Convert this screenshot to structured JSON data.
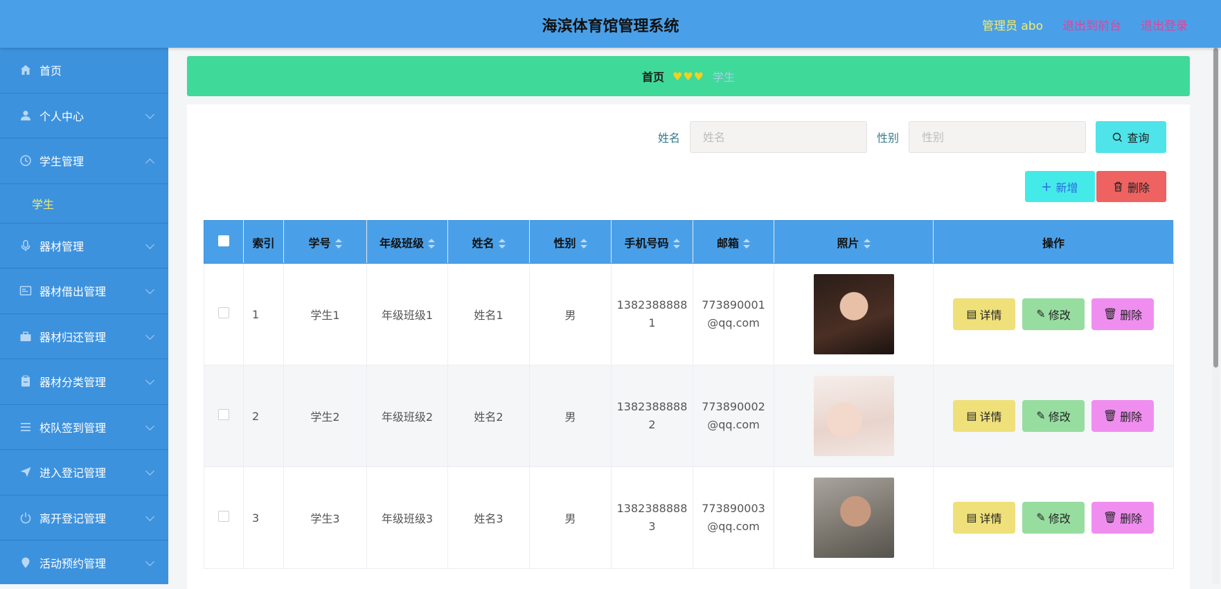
{
  "header": {
    "title": "海滨体育馆管理系统",
    "user": "管理员 abo",
    "to_front": "退出到前台",
    "logout": "退出登录"
  },
  "sidebar": {
    "items": [
      {
        "label": "首页",
        "icon": "home-icon"
      },
      {
        "label": "个人中心",
        "icon": "user-icon"
      },
      {
        "label": "学生管理",
        "icon": "clock-icon",
        "expanded": true
      },
      {
        "label": "器材管理",
        "icon": "microphone-icon"
      },
      {
        "label": "器材借出管理",
        "icon": "card-icon"
      },
      {
        "label": "器材归还管理",
        "icon": "briefcase-icon"
      },
      {
        "label": "器材分类管理",
        "icon": "clipboard-icon"
      },
      {
        "label": "校队签到管理",
        "icon": "list-icon"
      },
      {
        "label": "进入登记管理",
        "icon": "send-icon"
      },
      {
        "label": "离开登记管理",
        "icon": "power-icon"
      },
      {
        "label": "活动预约管理",
        "icon": "pin-icon"
      }
    ],
    "submenu_label": "学生"
  },
  "breadcrumb": {
    "home": "首页",
    "separator": "♥♥♥",
    "current": "学生"
  },
  "search": {
    "name_label": "姓名",
    "name_placeholder": "姓名",
    "gender_label": "性别",
    "gender_placeholder": "性别",
    "query_label": "查询"
  },
  "actions": {
    "add_label": "新增",
    "delete_label": "删除"
  },
  "table": {
    "headers": {
      "index": "索引",
      "student_no": "学号",
      "grade_class": "年级班级",
      "name": "姓名",
      "gender": "性别",
      "phone": "手机号码",
      "email": "邮箱",
      "photo": "照片",
      "ops": "操作"
    },
    "rows": [
      {
        "index": "1",
        "student_no": "学生1",
        "grade_class": "年级班级1",
        "name": "姓名1",
        "gender": "男",
        "phone": "13823888881",
        "email": "773890001@qq.com"
      },
      {
        "index": "2",
        "student_no": "学生2",
        "grade_class": "年级班级2",
        "name": "姓名2",
        "gender": "男",
        "phone": "13823888882",
        "email": "773890002@qq.com"
      },
      {
        "index": "3",
        "student_no": "学生3",
        "grade_class": "年级班级3",
        "name": "姓名3",
        "gender": "男",
        "phone": "13823888883",
        "email": "773890003@qq.com"
      }
    ],
    "op_labels": {
      "detail": "详情",
      "edit": "修改",
      "delete": "删除"
    }
  }
}
